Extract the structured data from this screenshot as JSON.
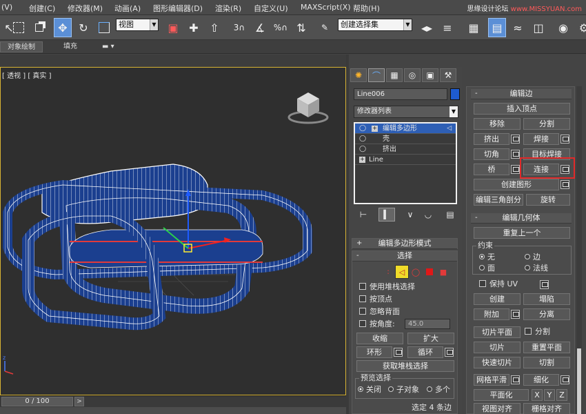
{
  "menubar": {
    "items": [
      "(V)",
      "创建(C)",
      "修改器(M)",
      "动画(A)",
      "图形编辑器(D)",
      "渲染(R)",
      "自定义(U)",
      "MAXScript(X)",
      "帮助(H)"
    ],
    "watermark_a": "思缘设计论坛",
    "watermark_b": "www.MISSYUAN.com"
  },
  "toolbar": {
    "view_select": "视图",
    "named_selection": "创建选择集",
    "icons": [
      "arrow-icon",
      "rect-select-icon",
      "window-crossing-icon",
      "move-icon",
      "rotate-icon",
      "scale-icon"
    ]
  },
  "ribbon": {
    "tabs": [
      "对象绘制",
      "填充"
    ]
  },
  "viewport": {
    "label": "[ 透视 ] [ 真实 ]"
  },
  "timeslider": {
    "value": "0 / 100",
    "next": ">"
  },
  "command_panel": {
    "object_name": "Line006",
    "object_color": "#1e5bcf",
    "modifier_list": "修改器列表",
    "stack": [
      {
        "label": "编辑多边形",
        "selected": true
      },
      {
        "label": "壳",
        "selected": false
      },
      {
        "label": "挤出",
        "selected": false
      },
      {
        "label": "Line",
        "selected": false
      }
    ],
    "edit_poly_mode": {
      "title": "编辑多边形模式"
    },
    "selection": {
      "title": "选择",
      "use_stack_selection": "使用堆栈选择",
      "by_vertex": "按顶点",
      "ignore_backfacing": "忽略背面",
      "by_angle": "按角度:",
      "angle_value": "45.0",
      "shrink": "收缩",
      "grow": "扩大",
      "ring": "环形",
      "loop": "循环",
      "get_stack_selection": "获取堆栈选择",
      "preview_title": "预览选择",
      "preview_options": [
        "关闭",
        "子对象",
        "多个"
      ],
      "status": "选定 4 条边"
    }
  },
  "edit_edges": {
    "title": "编辑边",
    "insert_vertex": "插入顶点",
    "remove": "移除",
    "split": "分割",
    "extrude": "挤出",
    "weld": "焊接",
    "chamfer": "切角",
    "target_weld": "目标焊接",
    "bridge": "桥",
    "connect": "连接",
    "create_shape": "创建图形",
    "edit_tri": "编辑三角剖分",
    "turn": "旋转"
  },
  "edit_geometry": {
    "title": "编辑几何体",
    "repeat_last": "重复上一个",
    "constraints_title": "约束",
    "constraints": [
      "无",
      "边",
      "面",
      "法线"
    ],
    "preserve_uv": "保持 UV",
    "create": "创建",
    "collapse": "塌陷",
    "attach": "附加",
    "detach": "分离",
    "slice_plane": "切片平面",
    "split": "分割",
    "slice": "切片",
    "reset_plane": "重置平面",
    "quickslice": "快速切片",
    "cut": "切割",
    "meshsmooth": "网格平滑",
    "tessellate": "细化",
    "make_planar": "平面化",
    "x": "X",
    "y": "Y",
    "z": "Z",
    "view_align": "视图对齐",
    "grid_align": "栅格对齐"
  }
}
